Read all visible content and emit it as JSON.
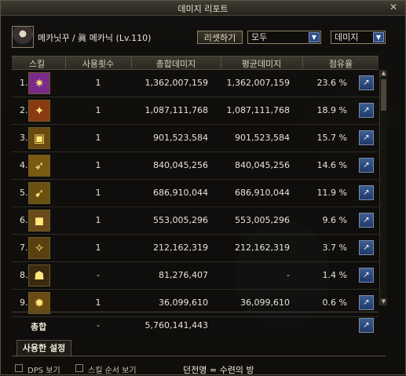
{
  "window": {
    "title": "데미지 리포트",
    "close_icon": "x"
  },
  "character": {
    "name": "메카닛꾸 / 眞 메카닉 (Lv.110)"
  },
  "controls": {
    "reset_label": "리셋하기",
    "filter_value": "모두",
    "metric_value": "데미지"
  },
  "table": {
    "headers": [
      "스킬",
      "사용횟수",
      "총합데미지",
      "평균데미지",
      "점유율"
    ],
    "rows": [
      {
        "index": "1.",
        "count": "1",
        "total": "1,362,007,159",
        "average": "1,362,007,159",
        "share": "23.6 %",
        "icon_color": "#7a2a8a"
      },
      {
        "index": "2.",
        "count": "1",
        "total": "1,087,111,768",
        "average": "1,087,111,768",
        "share": "18.9 %",
        "icon_color": "#8a3a10"
      },
      {
        "index": "3.",
        "count": "1",
        "total": "901,523,584",
        "average": "901,523,584",
        "share": "15.7 %",
        "icon_color": "#6a4a10"
      },
      {
        "index": "4.",
        "count": "1",
        "total": "840,045,256",
        "average": "840,045,256",
        "share": "14.6 %",
        "icon_color": "#7a5a10"
      },
      {
        "index": "5.",
        "count": "1",
        "total": "686,910,044",
        "average": "686,910,044",
        "share": "11.9 %",
        "icon_color": "#6a5010"
      },
      {
        "index": "6.",
        "count": "1",
        "total": "553,005,296",
        "average": "553,005,296",
        "share": "9.6 %",
        "icon_color": "#6a4a18"
      },
      {
        "index": "7.",
        "count": "1",
        "total": "212,162,319",
        "average": "212,162,319",
        "share": "3.7 %",
        "icon_color": "#5a4010"
      },
      {
        "index": "8.",
        "count": "-",
        "total": "81,276,407",
        "average": "-",
        "share": "1.4 %",
        "icon_color": "#3a2a10"
      },
      {
        "index": "9.",
        "count": "1",
        "total": "36,099,610",
        "average": "36,099,610",
        "share": "0.6 %",
        "icon_color": "#6a4a10"
      }
    ]
  },
  "summary": {
    "label": "총합",
    "count": "-",
    "total": "5,760,141,443"
  },
  "settings": {
    "tab_label": "사용한 설정"
  },
  "bottom": {
    "dps_label": "DPS 보기",
    "order_label": "스킬 순서 보기",
    "room_label": "던전명 = 수련의 방"
  }
}
